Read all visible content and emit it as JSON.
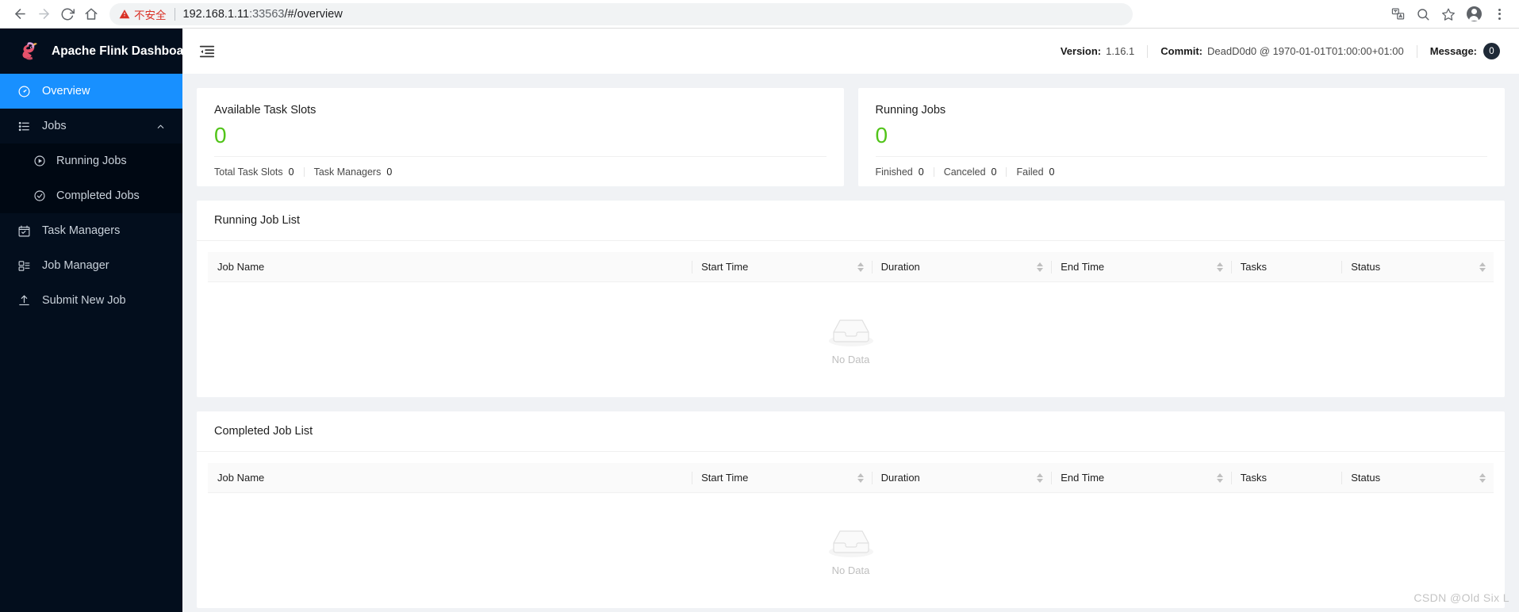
{
  "browser": {
    "back_icon": "arrow-left-icon",
    "forward_icon": "arrow-right-icon",
    "reload_icon": "reload-icon",
    "home_icon": "home-icon",
    "security_label": "不安全",
    "url_host": "192.168.1.11",
    "url_port": ":33563",
    "url_path": "/#/overview",
    "actions": [
      {
        "name": "translate-icon",
        "label": "Translate"
      },
      {
        "name": "search-icon",
        "label": "Search"
      },
      {
        "name": "bookmark-star-icon",
        "label": "Bookmark"
      },
      {
        "name": "profile-avatar-icon",
        "label": "Profile"
      },
      {
        "name": "more-menu-icon",
        "label": "More"
      }
    ]
  },
  "sidebar": {
    "brand": "Apache Flink Dashboard",
    "logo_icon": "flink-squirrel-logo",
    "items": [
      {
        "label": "Overview",
        "icon": "dashboard-icon",
        "active": true
      },
      {
        "label": "Jobs",
        "icon": "list-icon",
        "expanded": true,
        "chevron": "chevron-up-icon"
      },
      {
        "label": "Running Jobs",
        "icon": "play-circle-icon",
        "sub": true
      },
      {
        "label": "Completed Jobs",
        "icon": "check-circle-icon",
        "sub": true
      },
      {
        "label": "Task Managers",
        "icon": "task-manager-icon"
      },
      {
        "label": "Job Manager",
        "icon": "job-manager-icon"
      },
      {
        "label": "Submit New Job",
        "icon": "upload-icon"
      }
    ]
  },
  "topbar": {
    "menu_toggle_icon": "menu-fold-icon",
    "version_label": "Version:",
    "version_value": "1.16.1",
    "commit_label": "Commit:",
    "commit_value": "DeadD0d0 @ 1970-01-01T01:00:00+01:00",
    "message_label": "Message:",
    "message_count": "0"
  },
  "stats": [
    {
      "title": "Available Task Slots",
      "value": "0",
      "metrics": [
        {
          "name": "Total Task Slots",
          "value": "0"
        },
        {
          "name": "Task Managers",
          "value": "0"
        }
      ]
    },
    {
      "title": "Running Jobs",
      "value": "0",
      "metrics": [
        {
          "name": "Finished",
          "value": "0"
        },
        {
          "name": "Canceled",
          "value": "0"
        },
        {
          "name": "Failed",
          "value": "0"
        }
      ]
    }
  ],
  "tables": [
    {
      "title": "Running Job List",
      "columns": [
        {
          "label": "Job Name",
          "sortable": false
        },
        {
          "label": "Start Time",
          "sortable": true
        },
        {
          "label": "Duration",
          "sortable": true
        },
        {
          "label": "End Time",
          "sortable": true
        },
        {
          "label": "Tasks",
          "sortable": false
        },
        {
          "label": "Status",
          "sortable": true
        }
      ],
      "rows": [],
      "empty_text": "No Data",
      "empty_icon": "empty-inbox-icon"
    },
    {
      "title": "Completed Job List",
      "columns": [
        {
          "label": "Job Name",
          "sortable": false
        },
        {
          "label": "Start Time",
          "sortable": true
        },
        {
          "label": "Duration",
          "sortable": true
        },
        {
          "label": "End Time",
          "sortable": true
        },
        {
          "label": "Tasks",
          "sortable": false
        },
        {
          "label": "Status",
          "sortable": true
        }
      ],
      "rows": [],
      "empty_text": "No Data",
      "empty_icon": "empty-inbox-icon"
    }
  ],
  "watermark": "CSDN @Old Six L",
  "colors": {
    "accent": "#1890ff",
    "sidebar_bg": "#030e1d",
    "stat_green": "#52c41a",
    "insecure_red": "#d93025"
  }
}
